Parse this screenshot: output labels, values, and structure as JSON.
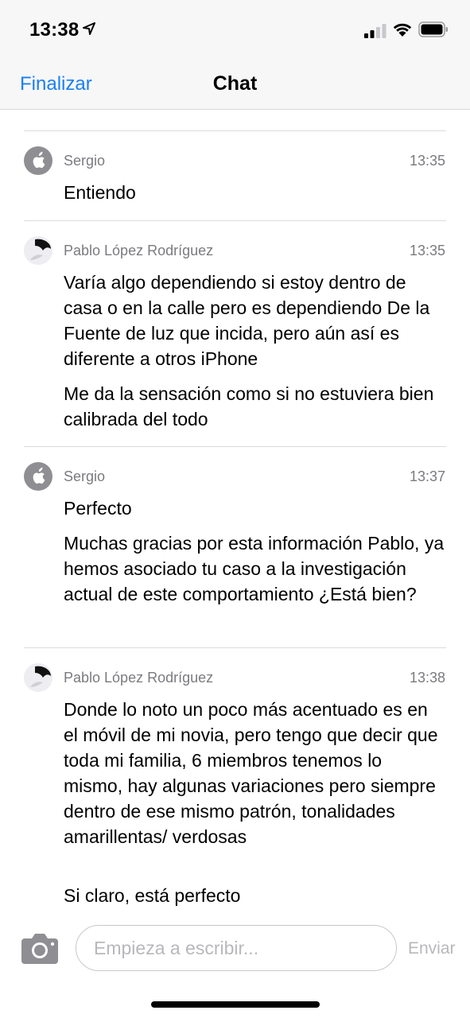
{
  "status_bar": {
    "time": "13:38"
  },
  "nav": {
    "left_button": "Finalizar",
    "title": "Chat"
  },
  "messages": [
    {
      "sender": "Sergio",
      "time": "13:35",
      "avatar": "apple-logo-icon",
      "paragraphs": [
        "Entiendo"
      ]
    },
    {
      "sender": "Pablo López Rodríguez",
      "time": "13:35",
      "avatar": "user-avatar",
      "paragraphs": [
        "Varía algo dependiendo si estoy dentro de casa o en la calle pero es dependiendo De la Fuente de luz que incida, pero aún así es diferente a otros iPhone",
        "Me da la sensación como si no estuviera bien calibrada del todo"
      ]
    },
    {
      "sender": "Sergio",
      "time": "13:37",
      "avatar": "apple-logo-icon",
      "paragraphs": [
        "Perfecto",
        "Muchas gracias por esta información Pablo, ya hemos asociado tu caso a la investigación actual de este comportamiento ¿Está bien?"
      ]
    },
    {
      "sender": "Pablo López Rodríguez",
      "time": "13:38",
      "avatar": "user-avatar",
      "paragraphs": [
        "Donde lo noto un poco más acentuado es en el móvil de mi novia, pero tengo que decir que toda mi familia, 6 miembros tenemos lo mismo, hay algunas variaciones pero siempre dentro de ese mismo patrón, tonalidades amarillentas/ verdosas",
        "Si claro, está perfecto"
      ]
    }
  ],
  "composer": {
    "placeholder": "Empieza a escribir...",
    "value": "",
    "send_label": "Enviar"
  },
  "colors": {
    "accent": "#1b7ff5",
    "secondary_text": "#7b7b80",
    "disabled": "#b8b8bc"
  }
}
